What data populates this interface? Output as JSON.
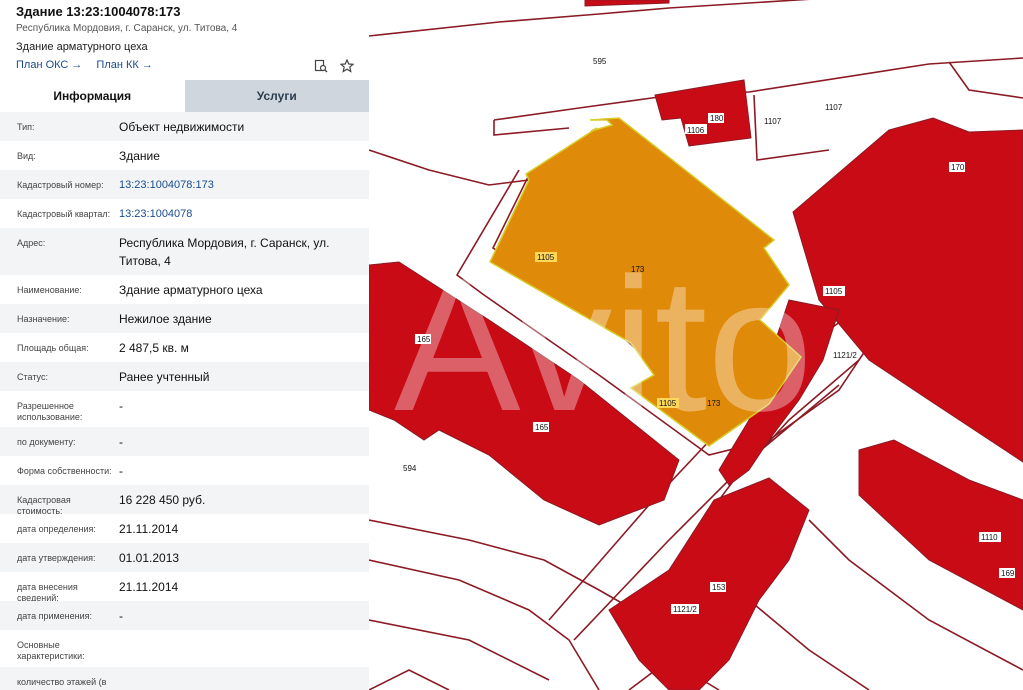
{
  "header": {
    "title": "Здание 13:23:1004078:173",
    "address": "Республика Мордовия, г. Саранск, ул. Титова, 4",
    "name": "Здание арматурного цеха",
    "link_oks": "План ОКС →",
    "link_kk": "План КК →"
  },
  "tabs": {
    "info": "Информация",
    "services": "Услуги"
  },
  "rows": [
    {
      "label": "Тип:",
      "value": "Объект недвижимости"
    },
    {
      "label": "Вид:",
      "value": "Здание"
    },
    {
      "label": "Кадастровый номер:",
      "value": "13:23:1004078:173"
    },
    {
      "label": "Кадастровый квартал:",
      "value": "13:23:1004078"
    },
    {
      "label": "Адрес:",
      "value": "Республика Мордовия, г. Саранск, ул. Титова, 4"
    },
    {
      "label": "Наименование:",
      "value": "Здание арматурного цеха"
    },
    {
      "label": "Назначение:",
      "value": "Нежилое здание"
    },
    {
      "label": "Площадь общая:",
      "value": "2 487,5 кв. м"
    },
    {
      "label": "Статус:",
      "value": "Ранее учтенный"
    },
    {
      "label": "Разрешенное использование:",
      "value": "-"
    },
    {
      "label": "по документу:",
      "value": "-"
    },
    {
      "label": "Форма собственности:",
      "value": "-"
    },
    {
      "label": "Кадастровая стоимость:",
      "value": "16 228 450 руб."
    },
    {
      "label": "дата определения:",
      "value": "21.11.2014"
    },
    {
      "label": "дата утверждения:",
      "value": "01.01.2013"
    },
    {
      "label": "дата внесения сведений:",
      "value": "21.11.2014"
    },
    {
      "label": "дата применения:",
      "value": "-"
    },
    {
      "label": "Основные характеристики:",
      "value": ""
    },
    {
      "label": "количество этажей (в том",
      "value": ""
    }
  ],
  "map": {
    "labels": {
      "l595": "595",
      "l180": "180",
      "l1106": "1106",
      "l1107a": "1107",
      "l1107b": "1107",
      "l170": "170",
      "l1105a": "1105",
      "l173a": "173",
      "l1105b": "1105",
      "l1105c": "1105",
      "l173b": "173",
      "l1121a": "1121/2",
      "l165a": "165",
      "l165b": "165",
      "l594": "594",
      "l153": "153",
      "l1121b": "1121/2",
      "l1110": "1110",
      "l169": "169"
    },
    "watermark": "Avito",
    "colors": {
      "parcel": "#c90b16",
      "selected": "#e08a0a",
      "outline": "#8b1a24"
    }
  }
}
